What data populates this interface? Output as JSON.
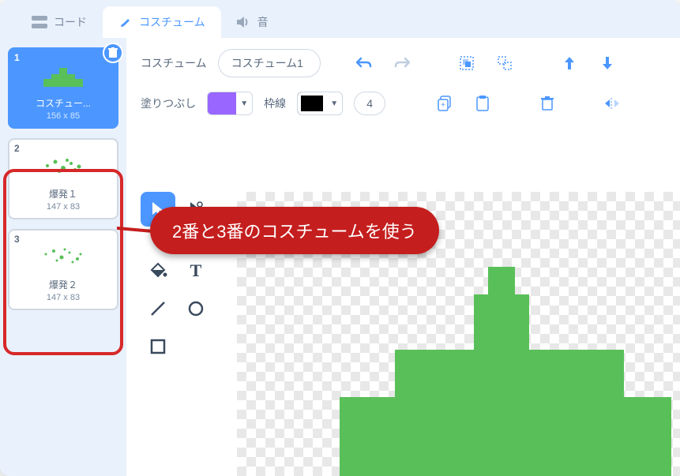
{
  "tabs": {
    "code": "コード",
    "costumes": "コスチューム",
    "sounds": "音"
  },
  "costumes": [
    {
      "num": "1",
      "name": "コスチュー...",
      "dim": "156 x 85"
    },
    {
      "num": "2",
      "name": "爆発１",
      "dim": "147 x 83"
    },
    {
      "num": "3",
      "name": "爆発２",
      "dim": "147 x 83"
    }
  ],
  "toolbar": {
    "costume_label": "コスチューム",
    "costume_name": "コスチューム1",
    "fill_label": "塗りつぶし",
    "outline_label": "枠線",
    "outline_width": "4"
  },
  "colors": {
    "fill": "#9966ff",
    "outline": "#000000",
    "sprite": "#59c059"
  },
  "annotation": "2番と3番のコスチュームを使う"
}
